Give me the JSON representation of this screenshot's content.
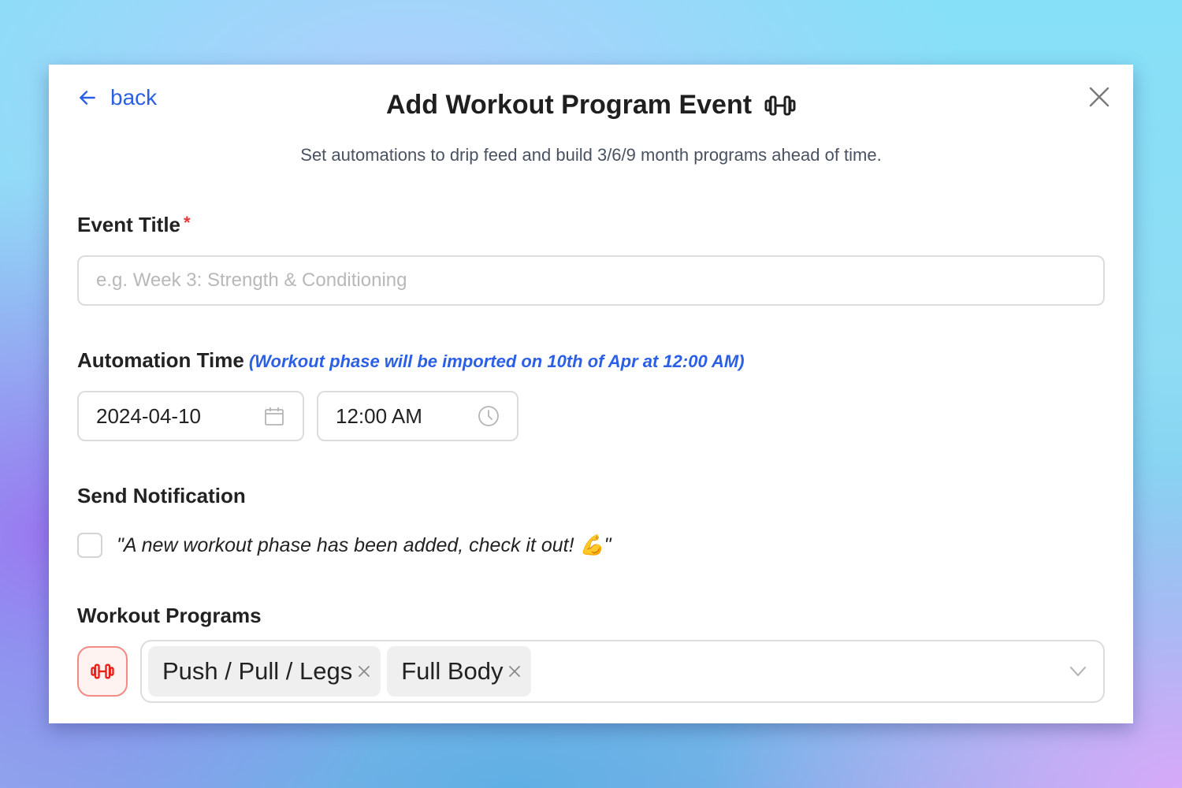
{
  "header": {
    "back_label": "back",
    "title": "Add Workout Program Event",
    "title_icon": "dumbbell-icon",
    "close_icon": "close-icon",
    "subtitle": "Set automations to drip feed and build 3/6/9 month programs ahead of time."
  },
  "event_title": {
    "label": "Event Title",
    "required_mark": "*",
    "value": "",
    "placeholder": "e.g. Week 3: Strength & Conditioning"
  },
  "automation": {
    "label": "Automation Time",
    "hint": "(Workout phase will be imported on 10th of Apr at 12:00 AM)",
    "date_value": "2024-04-10",
    "date_icon": "calendar-icon",
    "time_value": "12:00 AM",
    "time_icon": "clock-icon"
  },
  "notification": {
    "label": "Send Notification",
    "checked": false,
    "message": "\"A new workout phase has been added, check it out! 💪\""
  },
  "workout_programs": {
    "label": "Workout Programs",
    "icon": "dumbbell-icon",
    "selected": [
      {
        "label": "Push / Pull / Legs"
      },
      {
        "label": "Full Body"
      }
    ],
    "dropdown_icon": "chevron-down-icon"
  },
  "colors": {
    "accent_blue": "#2a5fe6",
    "required_red": "#e53935",
    "program_icon_red": "#e8211a"
  }
}
